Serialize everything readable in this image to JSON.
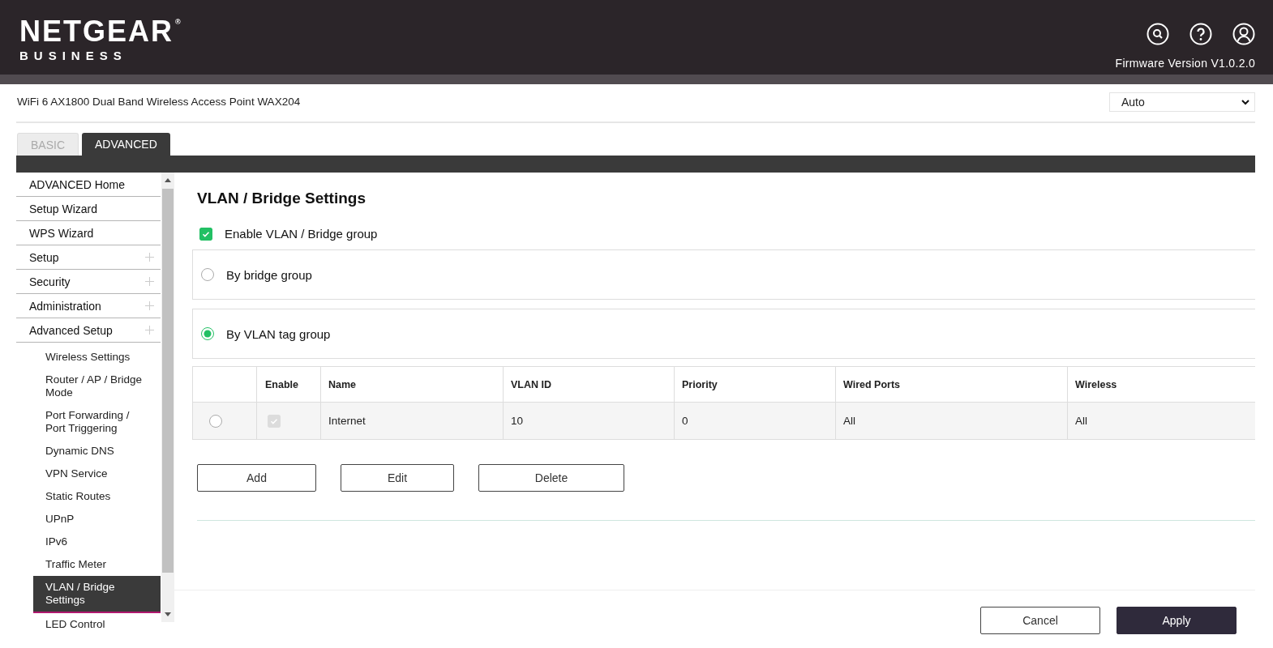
{
  "header": {
    "logo": "NETGEAR",
    "logo_mark": "®",
    "logo_sub": "BUSINESS",
    "firmware": "Firmware Version V1.0.2.0"
  },
  "device": {
    "title": "WiFi 6 AX1800 Dual Band Wireless Access Point WAX204",
    "mode_select": "Auto"
  },
  "tabs": [
    {
      "label": "BASIC",
      "selected": false
    },
    {
      "label": "ADVANCED",
      "selected": true
    }
  ],
  "sidebar": {
    "items": [
      {
        "label": "ADVANCED Home",
        "expandable": false
      },
      {
        "label": "Setup Wizard",
        "expandable": false
      },
      {
        "label": "WPS Wizard",
        "expandable": false
      },
      {
        "label": "Setup",
        "expandable": true
      },
      {
        "label": "Security",
        "expandable": true
      },
      {
        "label": "Administration",
        "expandable": true
      },
      {
        "label": "Advanced Setup",
        "expandable": true,
        "children": [
          {
            "label": "Wireless Settings",
            "selected": false
          },
          {
            "label": "Router / AP / Bridge Mode",
            "selected": false
          },
          {
            "label": "Port Forwarding / Port Triggering",
            "selected": false
          },
          {
            "label": "Dynamic DNS",
            "selected": false
          },
          {
            "label": "VPN Service",
            "selected": false
          },
          {
            "label": "Static Routes",
            "selected": false
          },
          {
            "label": "UPnP",
            "selected": false
          },
          {
            "label": "IPv6",
            "selected": false
          },
          {
            "label": "Traffic Meter",
            "selected": false
          },
          {
            "label": "VLAN / Bridge Settings",
            "selected": true
          },
          {
            "label": "LED Control",
            "selected": false
          }
        ]
      }
    ]
  },
  "page": {
    "title": "VLAN / Bridge Settings",
    "enable": {
      "label": "Enable VLAN / Bridge group",
      "checked": true
    },
    "modes": [
      {
        "label": "By bridge group",
        "selected": false
      },
      {
        "label": "By VLAN tag group",
        "selected": true
      }
    ],
    "table": {
      "columns": [
        "",
        "Enable",
        "Name",
        "VLAN ID",
        "Priority",
        "Wired Ports",
        "Wireless"
      ],
      "rows": [
        {
          "selected": false,
          "enabled": true,
          "disabled": true,
          "cells": [
            "",
            "",
            "Internet",
            "10",
            "0",
            "All",
            "All"
          ]
        }
      ]
    },
    "buttons": [
      "Add",
      "Edit",
      "Delete"
    ]
  },
  "footer": {
    "buttons": [
      {
        "label": "Cancel",
        "kind": "secondary"
      },
      {
        "label": "Apply",
        "kind": "primary"
      }
    ]
  }
}
